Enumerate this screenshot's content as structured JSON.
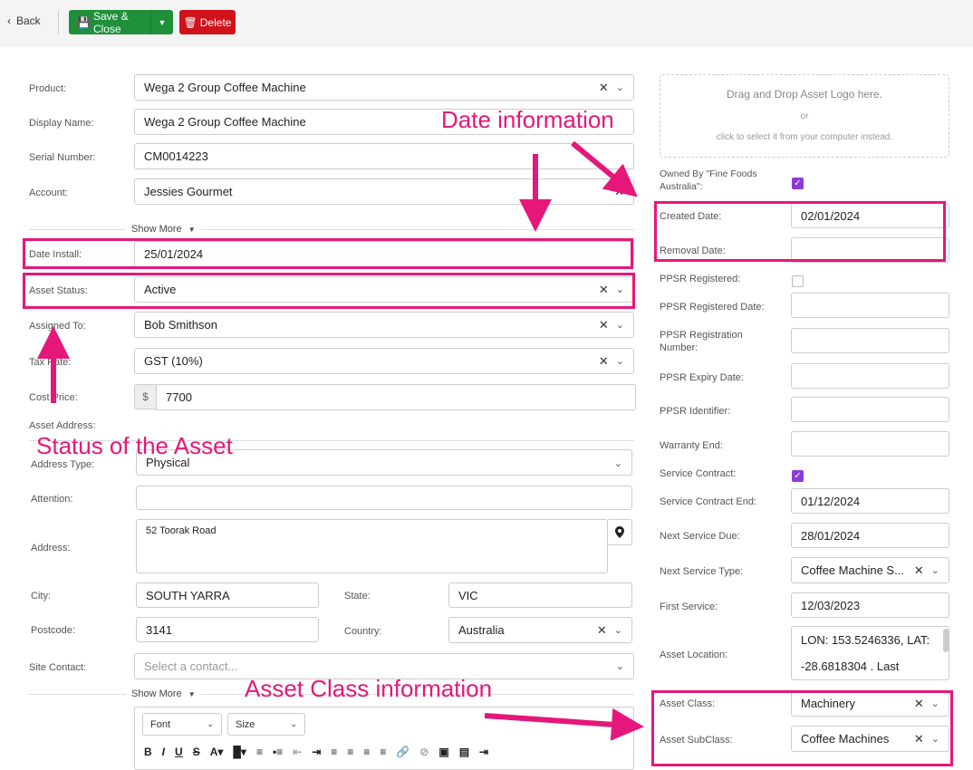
{
  "toolbar": {
    "back_label": "Back",
    "save_label": "Save & Close",
    "delete_label": "Delete"
  },
  "left": {
    "product": {
      "label": "Product:",
      "value": "Wega 2 Group Coffee Machine"
    },
    "display_name": {
      "label": "Display Name:",
      "value": "Wega 2 Group Coffee Machine"
    },
    "serial_number": {
      "label": "Serial Number:",
      "value": "CM0014223"
    },
    "account": {
      "label": "Account:",
      "value": "Jessies Gourmet"
    },
    "show_more_1": "Show More",
    "date_install": {
      "label": "Date Install:",
      "value": "25/01/2024"
    },
    "asset_status": {
      "label": "Asset Status:",
      "value": "Active"
    },
    "assigned_to": {
      "label": "Assigned To:",
      "value": "Bob Smithson"
    },
    "tax_rate": {
      "label": "Tax Rate:",
      "value": "GST (10%)"
    },
    "cost_price": {
      "label": "Cost Price:",
      "currency": "$",
      "value": "7700"
    },
    "asset_address_label": "Asset Address:",
    "address_type": {
      "label": "Address Type:",
      "value": "Physical"
    },
    "attention": {
      "label": "Attention:",
      "value": ""
    },
    "address": {
      "label": "Address:",
      "value": "52 Toorak Road"
    },
    "city": {
      "label": "City:",
      "value": "SOUTH YARRA"
    },
    "state": {
      "label": "State:",
      "value": "VIC"
    },
    "postcode": {
      "label": "Postcode:",
      "value": "3141"
    },
    "country": {
      "label": "Country:",
      "value": "Australia"
    },
    "site_contact": {
      "label": "Site Contact:",
      "placeholder": "Select a contact..."
    },
    "show_more_2": "Show More",
    "editor": {
      "font": "Font",
      "size": "Size"
    }
  },
  "right": {
    "drop_title": "Drag and Drop Asset Logo here.",
    "drop_or": "or",
    "drop_hint": "click to select it from your computer instead.",
    "owned_by": {
      "label": "Owned By \"Fine Foods Australia\":",
      "checked": true
    },
    "created_date": {
      "label": "Created Date:",
      "value": "02/01/2024"
    },
    "removal_date": {
      "label": "Removal Date:",
      "value": ""
    },
    "ppsr_registered": {
      "label": "PPSR Registered:",
      "checked": false
    },
    "ppsr_registered_date": {
      "label": "PPSR Registered Date:",
      "value": ""
    },
    "ppsr_registration_number": {
      "label": "PPSR Registration Number:",
      "value": ""
    },
    "ppsr_expiry_date": {
      "label": "PPSR Expiry Date:",
      "value": ""
    },
    "ppsr_identifier": {
      "label": "PPSR Identifier:",
      "value": ""
    },
    "warranty_end": {
      "label": "Warranty End:",
      "value": ""
    },
    "service_contract": {
      "label": "Service Contract:",
      "checked": true
    },
    "service_contract_end": {
      "label": "Service Contract End:",
      "value": "01/12/2024"
    },
    "next_service_due": {
      "label": "Next Service Due:",
      "value": "28/01/2024"
    },
    "next_service_type": {
      "label": "Next Service Type:",
      "value": "Coffee Machine S..."
    },
    "first_service": {
      "label": "First Service:",
      "value": "12/03/2023"
    },
    "asset_location": {
      "label": "Asset Location:",
      "line1": "LON: 153.5246336,  LAT:",
      "line2": "-28.6818304 . Last"
    },
    "asset_class": {
      "label": "Asset Class:",
      "value": "Machinery"
    },
    "asset_subclass": {
      "label": "Asset SubClass:",
      "value": "Coffee Machines"
    }
  },
  "annotations": {
    "date_info": "Date information",
    "status_info": "Status of the Asset",
    "class_info": "Asset Class information"
  },
  "colors": {
    "accent": "#e6177a",
    "save": "#1f8f3a",
    "delete": "#d0121b",
    "check": "#8b3bd9"
  }
}
